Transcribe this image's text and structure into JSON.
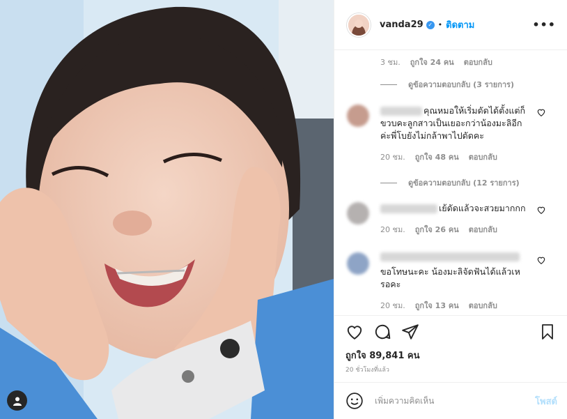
{
  "post": {
    "username": "vanda29",
    "verified_icon": "verified-badge-icon",
    "separator": "•",
    "follow_label": "ติดตาม",
    "more_icon": "more-horizontal-icon",
    "more_label": "•••"
  },
  "comments": {
    "top_meta": {
      "time": "3 ชม.",
      "likes": "ถูกใจ 24 คน",
      "reply": "ตอบกลับ"
    },
    "view_replies_1": "ดูข้อความตอบกลับ (3 รายการ)",
    "items": [
      {
        "text": "คุณหมอให้เริ่มดัดได้ตั้งแต่ก็ขวบคะลูกสาวเป็นเยอะกว่าน้องมะลิอีกค่ะพี่โบยังไม่กล้าพาไปดัดคะ",
        "time": "20 ชม.",
        "likes": "ถูกใจ 48 คน",
        "reply": "ตอบกลับ"
      },
      {
        "text": "เย้ดัดแล้วจะสวยมากกก",
        "time": "20 ชม.",
        "likes": "ถูกใจ 26 คน",
        "reply": "ตอบกลับ"
      },
      {
        "text": "ขอโทษนะคะ น้องมะลิจัดฟันได้แล้วเหรอคะ",
        "time": "20 ชม.",
        "likes": "ถูกใจ 13 คน",
        "reply": "ตอบกลับ"
      }
    ],
    "view_replies_2": "ดูข้อความตอบกลับ (12 รายการ)"
  },
  "actions": {
    "likes_count": "ถูกใจ 89,841 คน",
    "time_ago": "20 ชั่วโมงที่แล้ว"
  },
  "add_comment": {
    "placeholder": "เพิ่มความคิดเห็น",
    "post_label": "โพสต์"
  },
  "colors": {
    "link_blue": "#0095f6",
    "post_disabled": "#b2dffc",
    "muted": "#8e8e8e"
  }
}
